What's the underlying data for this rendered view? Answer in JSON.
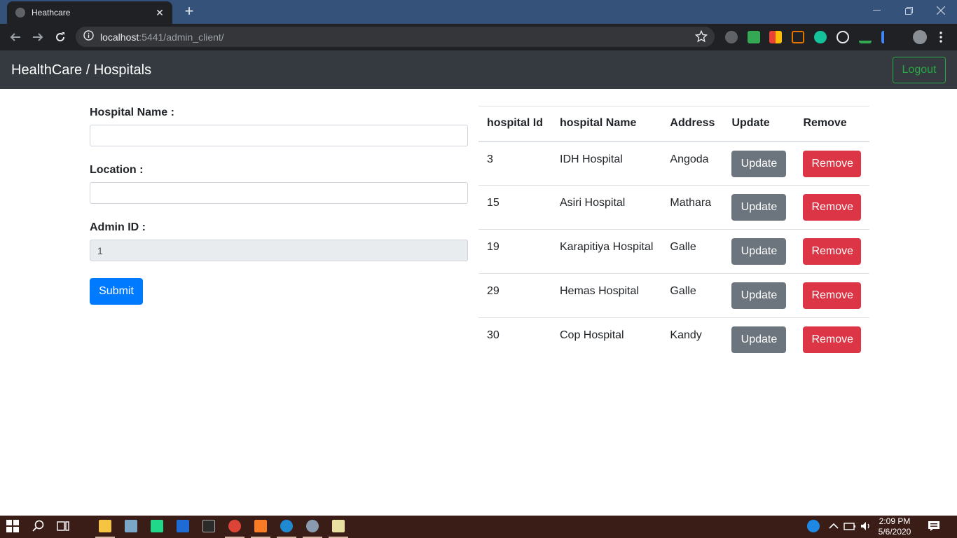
{
  "browser": {
    "tab_title": "Heathcare",
    "tab_close": "✕",
    "new_tab": "+",
    "url_host": "localhost",
    "url_rest": ":5441/admin_client/"
  },
  "navbar": {
    "brand": "HealthCare / Hospitals",
    "logout_label": "Logout"
  },
  "form": {
    "hospital_name_label": "Hospital Name :",
    "hospital_name_value": "",
    "location_label": "Location :",
    "location_value": "",
    "admin_id_label": "Admin ID :",
    "admin_id_value": "1",
    "submit_label": "Submit"
  },
  "table": {
    "headers": [
      "hospital Id",
      "hospital Name",
      "Address",
      "Update",
      "Remove"
    ],
    "rows": [
      {
        "id": "3",
        "name": "IDH Hospital",
        "address": "Angoda",
        "update": "Update",
        "remove": "Remove"
      },
      {
        "id": "15",
        "name": "Asiri Hospital",
        "address": "Mathara",
        "update": "Update",
        "remove": "Remove"
      },
      {
        "id": "19",
        "name": "Karapitiya Hospital",
        "address": "Galle",
        "update": "Update",
        "remove": "Remove"
      },
      {
        "id": "29",
        "name": "Hemas Hospital",
        "address": "Galle",
        "update": "Update",
        "remove": "Remove"
      },
      {
        "id": "30",
        "name": "Cop Hospital",
        "address": "Kandy",
        "update": "Update",
        "remove": "Remove"
      }
    ]
  },
  "taskbar": {
    "time": "2:09 PM",
    "date": "5/6/2020"
  },
  "colors": {
    "navbar_bg": "#343a40",
    "logout_outline": "#28a745",
    "submit_primary": "#007bff",
    "update_secondary": "#6c757d",
    "remove_danger": "#dc3545"
  }
}
